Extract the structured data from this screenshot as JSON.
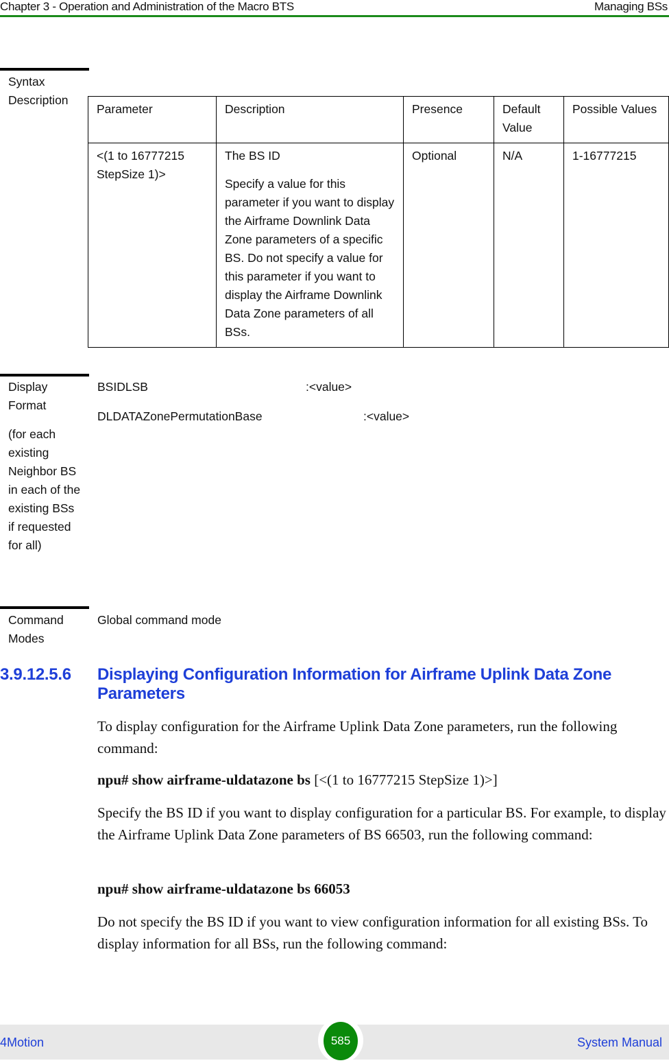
{
  "header": {
    "chapter": "Chapter 3 - Operation and Administration of the Macro BTS",
    "section": "Managing BSs"
  },
  "syntax_description": {
    "label_line1": "Syntax",
    "label_line2": "Description",
    "columns": [
      "Parameter",
      "Description",
      "Presence",
      "Default Value",
      "Possible Values"
    ],
    "rows": [
      {
        "parameter": "<(1 to 16777215 StepSize 1)>",
        "description_title": "The BS ID",
        "description_body": "Specify a value for this parameter if you want to display the Airframe Downlink Data Zone parameters of a specific BS. Do not specify a value for this parameter if you want to display the Airframe Downlink Data Zone parameters of all BSs.",
        "presence": "Optional",
        "default_value": "N/A",
        "possible_values": "1-16777215"
      }
    ]
  },
  "display_format": {
    "label": "Display Format",
    "note": "(for each existing Neighbor BS in each of the existing BSs if requested for all)",
    "lines": [
      {
        "name": "BSIDLSB",
        "value": ":<value>"
      },
      {
        "name": "DLDATAZonePermutationBase",
        "value": ":<value>"
      }
    ]
  },
  "command_modes": {
    "label": "Command Modes",
    "value": "Global command mode"
  },
  "section": {
    "number": "3.9.12.5.6",
    "title": "Displaying Configuration Information for Airframe Uplink Data Zone Parameters",
    "para1": "To display configuration for the Airframe Uplink Data Zone parameters, run the following command:",
    "cmd1_bold": "npu# show airframe-uldatazone bs",
    "cmd1_rest": " [<(1 to 16777215 StepSize 1)>]",
    "para2": "Specify the BS ID if you want to display configuration for a particular BS. For example, to display the Airframe Uplink Data Zone parameters of BS 66503, run the following command:",
    "cmd2": "npu# show airframe-uldatazone bs 66053",
    "para3": "Do not specify the BS ID if you want to view configuration information for all existing BSs. To display information for all BSs, run the following command:"
  },
  "footer": {
    "product": "4Motion",
    "page": "585",
    "manual": "System Manual"
  }
}
